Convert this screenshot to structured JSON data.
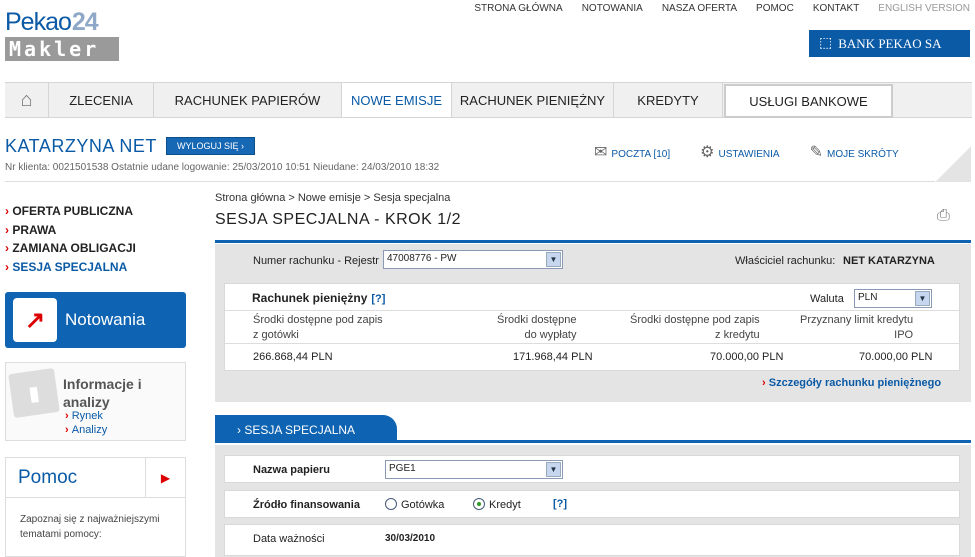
{
  "logo": {
    "brand": "Pekao",
    "number": "24",
    "sub": "Makler"
  },
  "topnav": [
    "STRONA GŁÓWNA",
    "NOTOWANIA",
    "NASZA OFERTA",
    "POMOC",
    "KONTAKT",
    "ENGLISH VERSION"
  ],
  "bank_badge": "BANK PEKAO SA",
  "mainnav": [
    "ZLECENIA",
    "RACHUNEK PAPIERÓW",
    "NOWE EMISJE",
    "RACHUNEK PIENIĘŻNY",
    "KREDYTY",
    "USŁUGI BANKOWE"
  ],
  "user": {
    "name": "KATARZYNA NET",
    "logout": "WYLOGUJ SIĘ",
    "info": "Nr klienta: 0021501538  Ostatnie udane logowanie:  25/03/2010 10:51  Nieudane: 24/03/2010 18:32",
    "links": [
      "POCZTA [10]",
      "USTAWIENIA",
      "MOJE SKRÓTY"
    ]
  },
  "leftmenu": [
    "OFERTA PUBLICZNA",
    "PRAWA",
    "ZAMIANA OBLIGACJI",
    "SESJA SPECJALNA"
  ],
  "notowania": "Notowania",
  "infobox": {
    "title1": "Informacje i",
    "title2": "analizy",
    "links": [
      "Rynek",
      "Analizy"
    ]
  },
  "pomoc": {
    "title": "Pomoc",
    "text": "Zapoznaj się z najważniejszymi tematami pomocy:"
  },
  "breadcrumb": "Strona główna > Nowe emisje > Sesja specjalna",
  "page_title": "SESJA SPECJALNA - KROK 1/2",
  "account": {
    "label": "Numer rachunku - Rejestr",
    "value": "47008776 - PW",
    "owner_label": "Właściciel rachunku:",
    "owner": "NET KATARZYNA"
  },
  "cash": {
    "title": "Rachunek pieniężny",
    "help": "[?]",
    "currency_label": "Waluta",
    "currency": "PLN",
    "headers": [
      [
        "Środki dostępne pod zapis",
        "z gotówki"
      ],
      [
        "Środki dostępne",
        "do wypłaty"
      ],
      [
        "Środki dostępne pod zapis",
        "z kredytu"
      ],
      [
        "Przyznany limit kredytu",
        "IPO"
      ]
    ],
    "values": [
      "266.868,44  PLN",
      "171.968,44  PLN",
      "70.000,00  PLN",
      "70.000,00  PLN"
    ]
  },
  "details_link": "Szczegóły rachunku pieniężnego",
  "tab": "SESJA SPECJALNA",
  "form": {
    "paper_label": "Nazwa papieru",
    "paper_value": "PGE1",
    "source_label": "Źródło finansowania",
    "opt1": "Gotówka",
    "opt2": "Kredyt",
    "help": "[?]",
    "selected": "Kredyt",
    "validity_label": "Data ważności",
    "validity": "30/03/2010"
  }
}
